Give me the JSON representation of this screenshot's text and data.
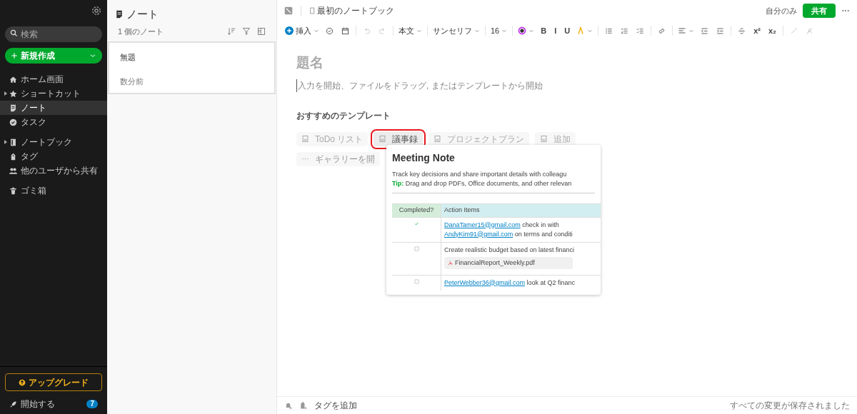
{
  "sidebar": {
    "search": {
      "placeholder": "検索"
    },
    "new_button": "新規作成",
    "sections": [
      {
        "items": [
          {
            "label": "ホーム画面",
            "selected": false,
            "expandable": false
          },
          {
            "label": "ショートカット",
            "selected": false,
            "expandable": true
          },
          {
            "label": "ノート",
            "selected": true,
            "expandable": false
          },
          {
            "label": "タスク",
            "selected": false,
            "expandable": false
          }
        ]
      },
      {
        "items": [
          {
            "label": "ノートブック",
            "selected": false,
            "expandable": true
          },
          {
            "label": "タグ",
            "selected": false,
            "expandable": false
          },
          {
            "label": "他のユーザから共有",
            "selected": false,
            "expandable": false
          }
        ]
      },
      {
        "items": [
          {
            "label": "ゴミ箱",
            "selected": false,
            "expandable": false
          }
        ]
      }
    ],
    "upgrade_button": "アップグレード",
    "getting_started": {
      "label": "開始する",
      "badge": "7"
    }
  },
  "note_list": {
    "title": "ノート",
    "count": "1 個のノート",
    "notes": [
      {
        "title": "無題",
        "time": "数分前",
        "selected": true
      }
    ]
  },
  "editor": {
    "notebook": "最初のノートブック",
    "visibility": "自分のみ",
    "share_button": "共有",
    "toolbar": [
      {
        "kind": "insert",
        "label": "挿入"
      },
      {
        "kind": "icon",
        "disabled": false
      },
      {
        "kind": "icon",
        "disabled": false
      },
      {
        "kind": "sep"
      },
      {
        "kind": "icon",
        "disabled": true
      },
      {
        "kind": "icon",
        "disabled": true
      },
      {
        "kind": "sep"
      },
      {
        "kind": "dropdown",
        "label": "本文"
      },
      {
        "kind": "sep"
      },
      {
        "kind": "dropdown",
        "label": "サンセリフ"
      },
      {
        "kind": "sep"
      },
      {
        "kind": "dropdown",
        "label": "16"
      },
      {
        "kind": "sep"
      },
      {
        "kind": "color"
      },
      {
        "kind": "text",
        "label": "B"
      },
      {
        "kind": "text",
        "label": "I"
      },
      {
        "kind": "text",
        "label": "U"
      },
      {
        "kind": "highlight"
      },
      {
        "kind": "sep"
      },
      {
        "kind": "icon",
        "disabled": false
      },
      {
        "kind": "icon",
        "disabled": false
      },
      {
        "kind": "icon",
        "disabled": false
      },
      {
        "kind": "sep"
      },
      {
        "kind": "icon",
        "disabled": false
      },
      {
        "kind": "sep"
      },
      {
        "kind": "align"
      },
      {
        "kind": "icon",
        "disabled": false
      },
      {
        "kind": "icon",
        "disabled": false
      },
      {
        "kind": "sep"
      },
      {
        "kind": "icon",
        "disabled": false
      },
      {
        "kind": "text",
        "label": "x²"
      },
      {
        "kind": "text",
        "label": "x₂"
      },
      {
        "kind": "sep"
      },
      {
        "kind": "icon",
        "disabled": true
      },
      {
        "kind": "icon",
        "disabled": true
      }
    ],
    "title_placeholder": "題名",
    "body_placeholder": "入力を開始、ファイルをドラッグ, またはテンプレートから開始",
    "templates_heading": "おすすめのテンプレート",
    "templates": [
      {
        "label": "ToDo リスト",
        "selected": false
      },
      {
        "label": "議事録",
        "selected": true
      },
      {
        "label": "プロジェクトプラン",
        "selected": false
      },
      {
        "label": "追加",
        "selected": false
      }
    ],
    "gallery_button": "ギャラリーを開",
    "preview": {
      "title": "Meeting Note",
      "description": "Track key decisions and share important details with colleagu",
      "tip_label": "Tip:",
      "tip": "Drag and drop PDFs, Office documents, and other relevan",
      "columns": [
        "Completed?",
        "Action Items"
      ],
      "rows": [
        {
          "checked": true,
          "parts": [
            {
              "kind": "link",
              "text": "DanaTamer15@gmail.com"
            },
            {
              "kind": "text",
              "text": " check in with "
            },
            {
              "kind": "link",
              "text": "AndyKim91@gmail.com"
            },
            {
              "kind": "text",
              "text": " on terms and conditi"
            }
          ]
        },
        {
          "checked": false,
          "parts": [
            {
              "kind": "text",
              "text": "Create realistic budget based on latest financi"
            }
          ],
          "attachment": "FinancialReport_Weekly.pdf"
        },
        {
          "checked": false,
          "parts": [
            {
              "kind": "link",
              "text": "PeterWebber36@gmail.com"
            },
            {
              "kind": "text",
              "text": " look at Q2 financ"
            }
          ]
        }
      ]
    },
    "add_tag": "タグを追加",
    "save_status": "すべての変更が保存されました"
  }
}
